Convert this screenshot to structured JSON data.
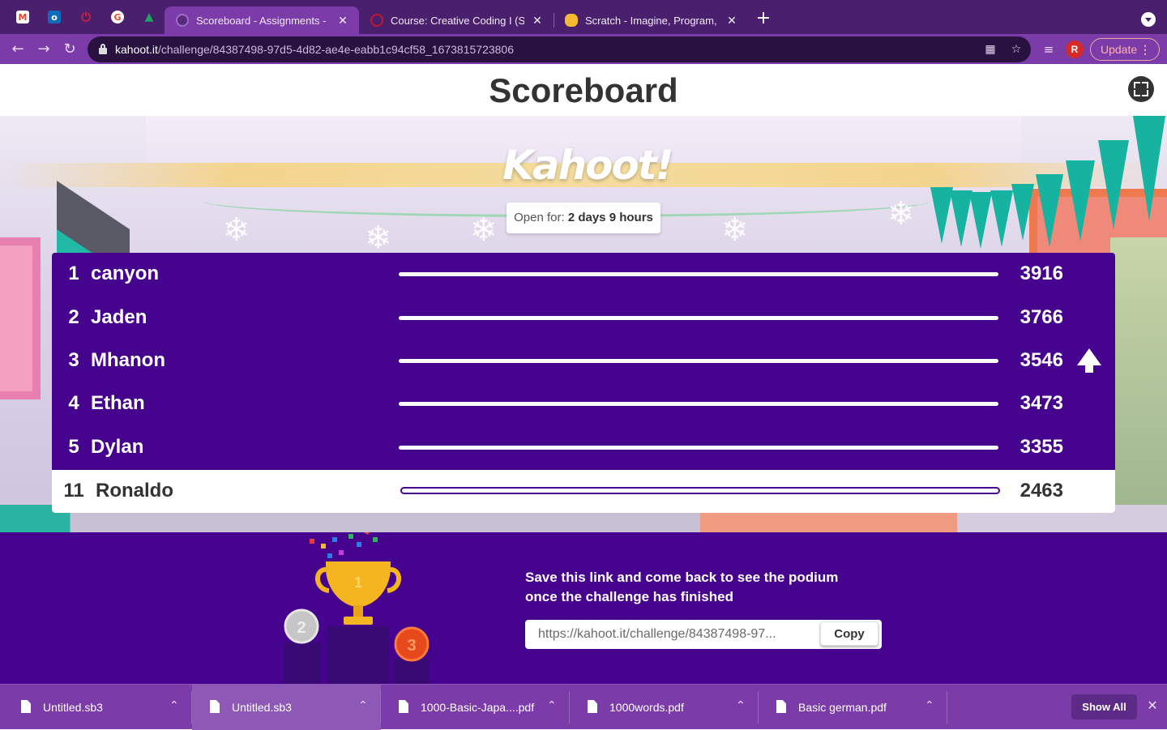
{
  "browser": {
    "pinned_tabs": [
      {
        "icon": "gmail-icon",
        "glyph": "M",
        "color": "#ea4335"
      },
      {
        "icon": "outlook-icon",
        "glyph": "o",
        "color": "#0f6cbd"
      },
      {
        "icon": "power-icon",
        "glyph": "⏻",
        "color": "#b01e2e"
      },
      {
        "icon": "google-circle-icon",
        "glyph": "G",
        "color": "#e84b3c"
      },
      {
        "icon": "drive-icon",
        "glyph": "▲",
        "color": "#1fa463"
      }
    ],
    "tabs": [
      {
        "title": "Scoreboard - Assignments - Ka",
        "active": true
      },
      {
        "title": "Course: Creative Coding I (Sec",
        "active": false
      },
      {
        "title": "Scratch - Imagine, Program, Sh",
        "active": false
      }
    ],
    "url_host": "kahoot.it",
    "url_path": "/challenge/84387498-97d5-4d82-ae4e-eabb1c94cf58_1673815723806",
    "profile_initial": "R",
    "update_label": "Update"
  },
  "page": {
    "title": "Scoreboard",
    "logo_text": "Kahoot!",
    "open_for_label": "Open for:",
    "open_for_value": "2 days 9 hours"
  },
  "leaderboard": {
    "rows": [
      {
        "rank": "1",
        "name": "canyon",
        "score": "3916",
        "fill": 1.0,
        "moved_up": false
      },
      {
        "rank": "2",
        "name": "Jaden",
        "score": "3766",
        "fill": 1.0,
        "moved_up": false
      },
      {
        "rank": "3",
        "name": "Mhanon",
        "score": "3546",
        "fill": 1.0,
        "moved_up": true
      },
      {
        "rank": "4",
        "name": "Ethan",
        "score": "3473",
        "fill": 1.0,
        "moved_up": false
      },
      {
        "rank": "5",
        "name": "Dylan",
        "score": "3355",
        "fill": 1.0,
        "moved_up": false
      }
    ],
    "current_player": {
      "rank": "11",
      "name": "Ronaldo",
      "score": "2463"
    }
  },
  "footer": {
    "save_message_line1": "Save this link and come back to see the podium",
    "save_message_line2": "once the challenge has finished",
    "link_value": "https://kahoot.it/challenge/84387498-97...",
    "copy_label": "Copy",
    "podium_labels": [
      "1",
      "2",
      "3"
    ]
  },
  "downloads": {
    "items": [
      {
        "name": "Untitled.sb3",
        "selected": false
      },
      {
        "name": "Untitled.sb3",
        "selected": true
      },
      {
        "name": "1000-Basic-Japa....pdf",
        "selected": false
      },
      {
        "name": "1000words.pdf",
        "selected": false
      },
      {
        "name": "Basic german.pdf",
        "selected": false
      }
    ],
    "show_all_label": "Show All"
  },
  "colors": {
    "kahoot_purple": "#46038e",
    "chrome_purple": "#7b3ba8",
    "tabstrip": "#4a1f6e"
  }
}
